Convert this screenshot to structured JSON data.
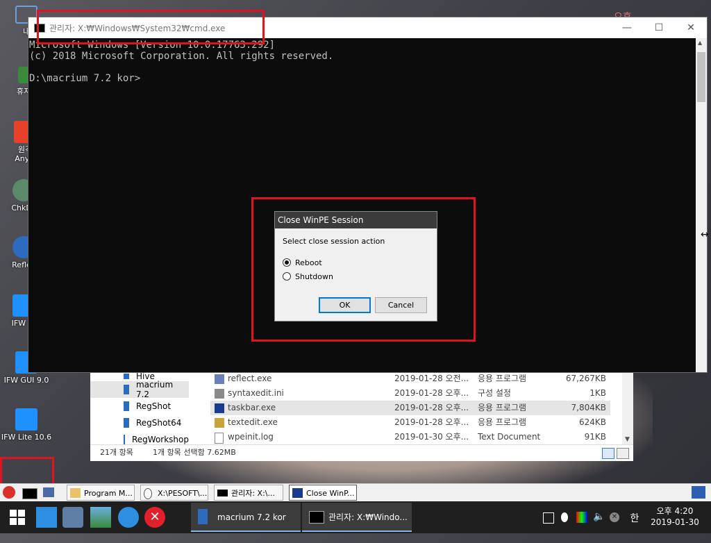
{
  "desktop": {
    "icons": [
      {
        "label": "내"
      },
      {
        "label": "휴지"
      },
      {
        "label": "원격\nAnyD"
      },
      {
        "label": "ChkDs"
      },
      {
        "label": "Reflec"
      },
      {
        "label": "IFW BI"
      },
      {
        "label": "IFW GUI 9.0"
      },
      {
        "label": "IFW Lite 10.6"
      }
    ],
    "corner_text": "오후"
  },
  "cmd_window": {
    "title": "관리자: X:₩Windows₩System32₩cmd.exe",
    "minimize": "—",
    "maximize": "☐",
    "close": "✕",
    "console_lines": [
      "Microsoft Windows [Version 10.0.17763.292]",
      "(c) 2018 Microsoft Corporation. All rights reserved.",
      "",
      "D:\\macrium 7.2 kor>"
    ]
  },
  "dialog": {
    "title": "Close WinPE Session",
    "prompt": "Select close session action",
    "options": [
      {
        "label": "Reboot",
        "selected": true
      },
      {
        "label": "Shutdown",
        "selected": false
      }
    ],
    "ok_label": "OK",
    "cancel_label": "Cancel"
  },
  "explorer": {
    "nav_items": [
      {
        "label": "Hive",
        "selected": false
      },
      {
        "label": "macrium 7.2",
        "selected": true
      },
      {
        "label": "RegShot",
        "selected": false
      },
      {
        "label": "RegShot64",
        "selected": false
      },
      {
        "label": "RegWorkshop",
        "selected": false
      }
    ],
    "files": [
      {
        "name": "reflect.exe",
        "date": "2019-01-28 오전...",
        "type": "응용 프로그램",
        "size": "67,267KB",
        "selected": false
      },
      {
        "name": "syntaxedit.ini",
        "date": "2019-01-28 오후...",
        "type": "구성 설정",
        "size": "1KB",
        "selected": false
      },
      {
        "name": "taskbar.exe",
        "date": "2019-01-28 오후...",
        "type": "응용 프로그램",
        "size": "7,804KB",
        "selected": true
      },
      {
        "name": "textedit.exe",
        "date": "2019-01-28 오후...",
        "type": "응용 프로그램",
        "size": "624KB",
        "selected": false
      },
      {
        "name": "wpeinit.log",
        "date": "2019-01-30 오후...",
        "type": "Text Document",
        "size": "91KB",
        "selected": false
      }
    ],
    "status_count": "21개 항목",
    "status_selection": "1개 항목 선택함 7.62MB"
  },
  "secondary_taskbar": {
    "tasks": [
      {
        "label": "Program M..."
      },
      {
        "label": "X:\\PESOFT\\..."
      },
      {
        "label": "관리자: X:\\..."
      },
      {
        "label": "Close WinP..."
      }
    ]
  },
  "taskbar": {
    "apps": [
      {
        "label": "macrium 7.2 kor"
      },
      {
        "label": "관리자: X:₩Windo..."
      }
    ],
    "ime": "한",
    "time": "오후 4:20",
    "date": "2019-01-30"
  },
  "colors": {
    "highlight_box": "#e0141e",
    "dialog_title_bg": "#3b3b3b",
    "console_bg": "#0c0c0c",
    "taskbar_bg": "#1f1f1f"
  }
}
